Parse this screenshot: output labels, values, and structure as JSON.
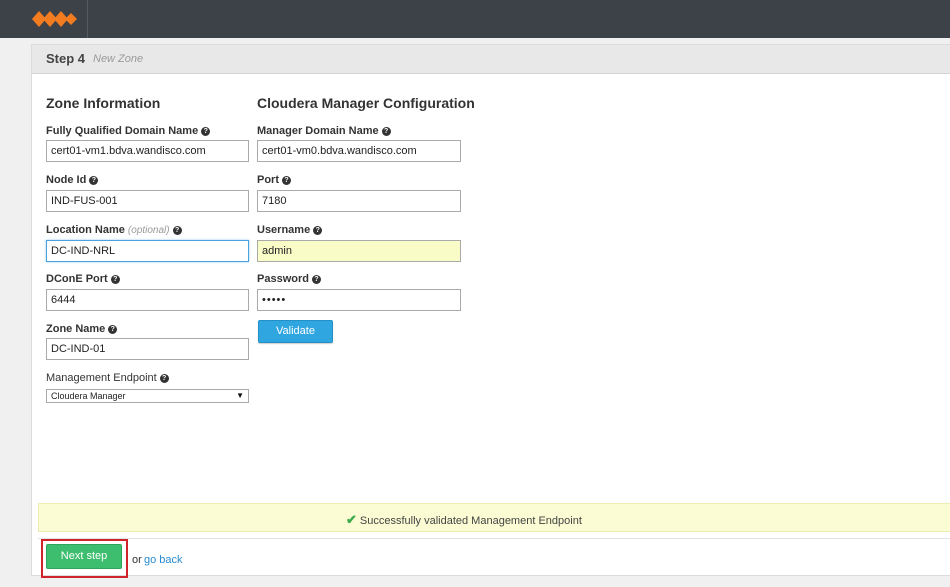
{
  "app": {
    "logo_icon": "wandisco-logo-icon",
    "brand_color": "#f47c20"
  },
  "step": {
    "title": "Step 4",
    "subtitle": "New Zone"
  },
  "zone": {
    "heading": "Zone Information",
    "fqdn_label": "Fully Qualified Domain Name",
    "fqdn_value": "cert01-vm1.bdva.wandisco.com",
    "node_id_label": "Node Id",
    "node_id_value": "IND-FUS-001",
    "location_label": "Location Name",
    "location_optional": "(optional)",
    "location_value": "DC-IND-NRL",
    "dcone_port_label": "DConE Port",
    "dcone_port_value": "6444",
    "zone_name_label": "Zone Name",
    "zone_name_value": "DC-IND-01",
    "endpoint_label": "Management Endpoint",
    "endpoint_value": "Cloudera Manager"
  },
  "cloudera": {
    "heading": "Cloudera Manager Configuration",
    "domain_label": "Manager Domain Name",
    "domain_value": "cert01-vm0.bdva.wandisco.com",
    "port_label": "Port",
    "port_value": "7180",
    "username_label": "Username",
    "username_value": "admin",
    "password_label": "Password",
    "password_value": "•••••",
    "validate_label": "Validate"
  },
  "status": {
    "icon": "check-icon",
    "message": "Successfully validated Management Endpoint"
  },
  "footer": {
    "next_label": "Next step",
    "or_text": "or",
    "back_label": "go back"
  }
}
